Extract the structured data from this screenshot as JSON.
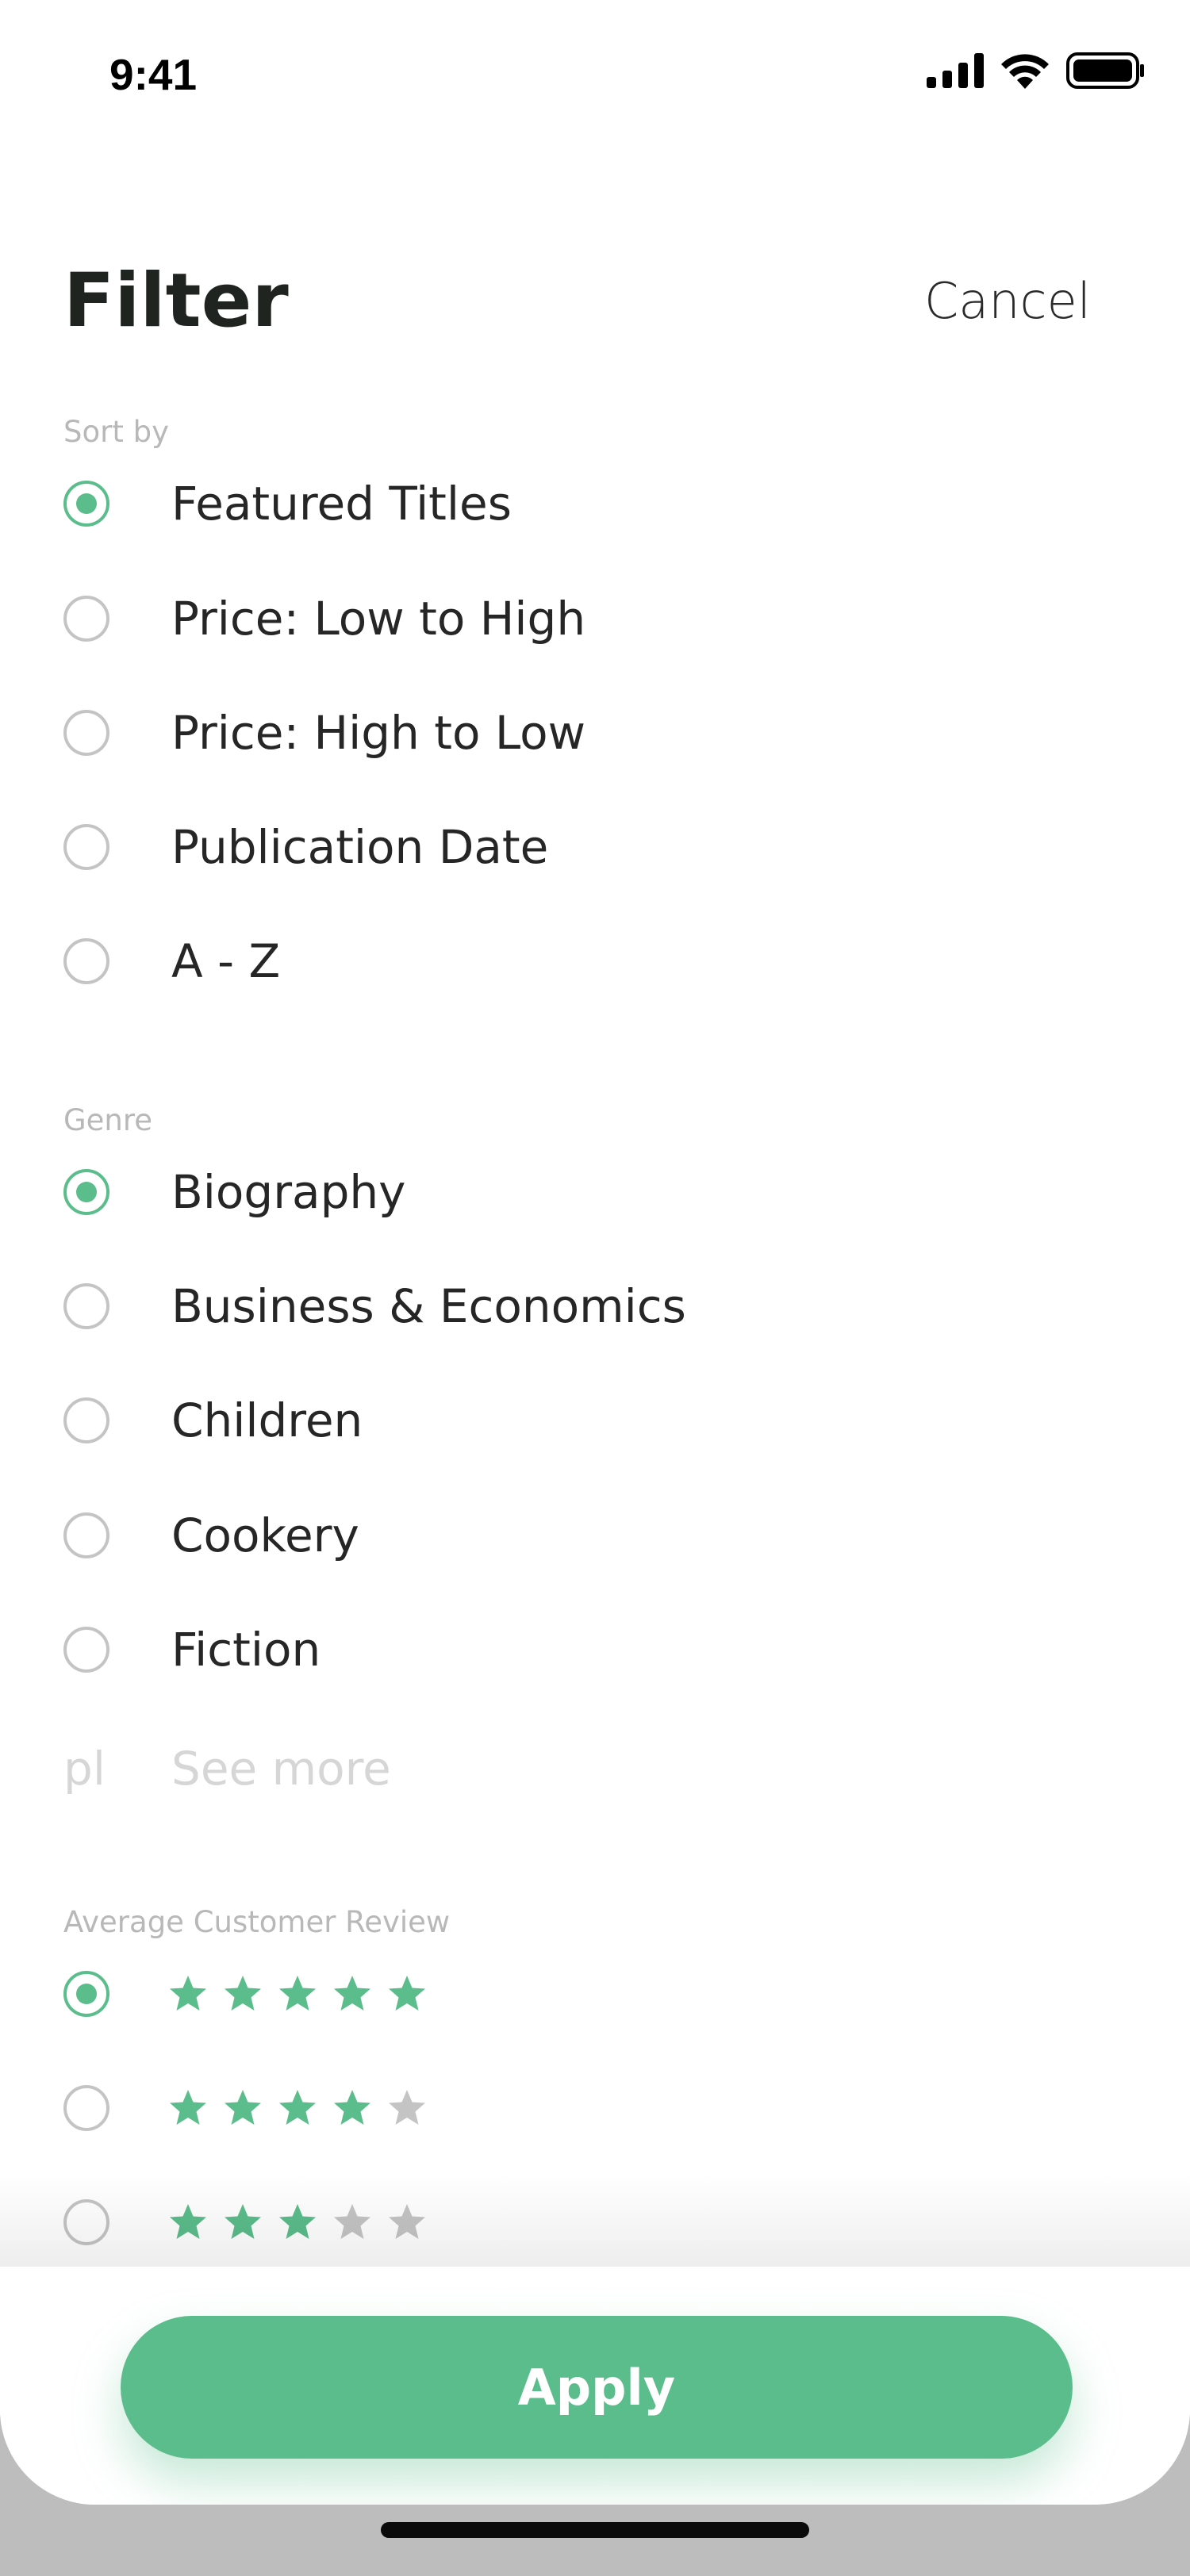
{
  "status_bar": {
    "time": "9:41"
  },
  "header": {
    "title": "Filter",
    "cancel_label": "Cancel"
  },
  "sort_by": {
    "label": "Sort by",
    "options": [
      {
        "label": "Featured Titles",
        "selected": true
      },
      {
        "label": "Price: Low to High",
        "selected": false
      },
      {
        "label": "Price: High to Low",
        "selected": false
      },
      {
        "label": "Publication Date",
        "selected": false
      },
      {
        "label": "A - Z",
        "selected": false
      }
    ]
  },
  "genre": {
    "label": "Genre",
    "options": [
      {
        "label": "Biography",
        "selected": true
      },
      {
        "label": "Business & Economics",
        "selected": false
      },
      {
        "label": "Children",
        "selected": false
      },
      {
        "label": "Cookery",
        "selected": false
      },
      {
        "label": "Fiction",
        "selected": false
      }
    ],
    "see_more_icon_text": "pl",
    "see_more_label": "See more"
  },
  "review": {
    "label": "Average Customer Review",
    "options": [
      {
        "stars": 5,
        "selected": true
      },
      {
        "stars": 4,
        "selected": false
      },
      {
        "stars": 3,
        "selected": false
      }
    ],
    "max_stars": 5
  },
  "apply_label": "Apply",
  "colors": {
    "accent": "#5bbd8b",
    "star_empty": "#c4c4c4",
    "radio_border": "#c4c4c4"
  }
}
